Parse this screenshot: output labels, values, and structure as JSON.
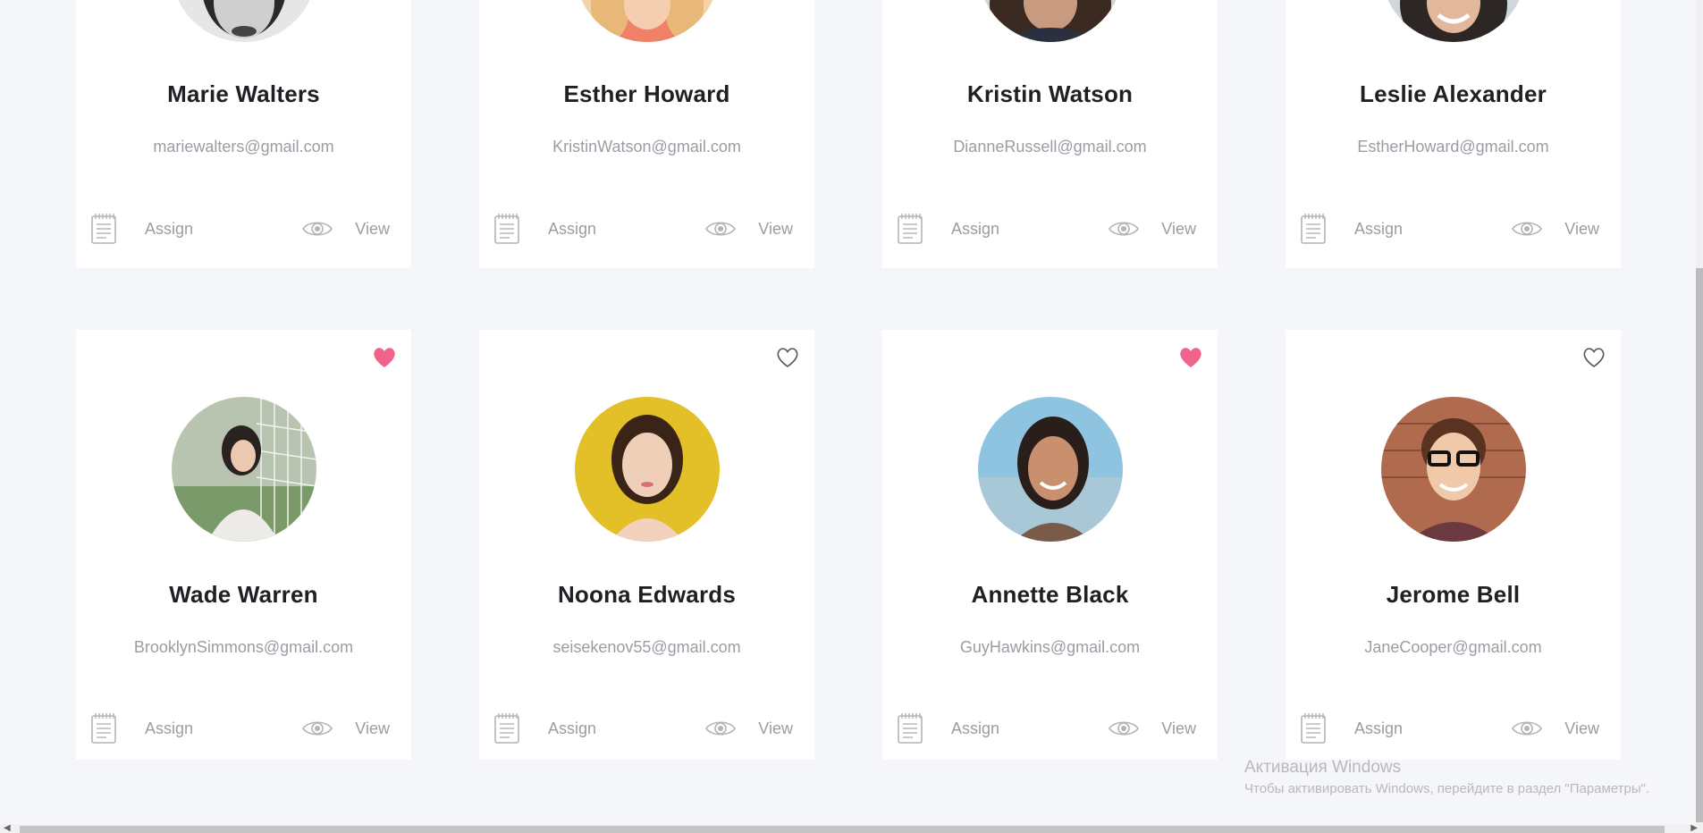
{
  "cards": [
    {
      "name": "Marie Walters",
      "email": "mariewalters@gmail.com",
      "assign": "Assign",
      "view": "View"
    },
    {
      "name": "Esther Howard",
      "email": "KristinWatson@gmail.com",
      "assign": "Assign",
      "view": "View"
    },
    {
      "name": "Kristin Watson",
      "email": "DianneRussell@gmail.com",
      "assign": "Assign",
      "view": "View"
    },
    {
      "name": "Leslie Alexander",
      "email": "EstherHoward@gmail.com",
      "assign": "Assign",
      "view": "View"
    },
    {
      "name": "Wade Warren",
      "email": "BrooklynSimmons@gmail.com",
      "assign": "Assign",
      "view": "View",
      "favorite": true
    },
    {
      "name": "Noona Edwards",
      "email": "seisekenov55@gmail.com",
      "assign": "Assign",
      "view": "View",
      "favorite": false
    },
    {
      "name": "Annette Black",
      "email": "GuyHawkins@gmail.com",
      "assign": "Assign",
      "view": "View",
      "favorite": true
    },
    {
      "name": "Jerome Bell",
      "email": "JaneCooper@gmail.com",
      "assign": "Assign",
      "view": "View",
      "favorite": false
    }
  ],
  "icons": {
    "heart": "heart-icon",
    "assign": "notepad-icon",
    "view": "eye-icon"
  },
  "colors": {
    "background": "#f5f6fa",
    "card": "#ffffff",
    "heart_active": "#f0648c",
    "muted_text": "#9c9ca4",
    "name_text": "#1f1f24"
  },
  "watermark": {
    "title": "Активация Windows",
    "subtitle": "Чтобы активировать Windows, перейдите в раздел \"Параметры\"."
  }
}
